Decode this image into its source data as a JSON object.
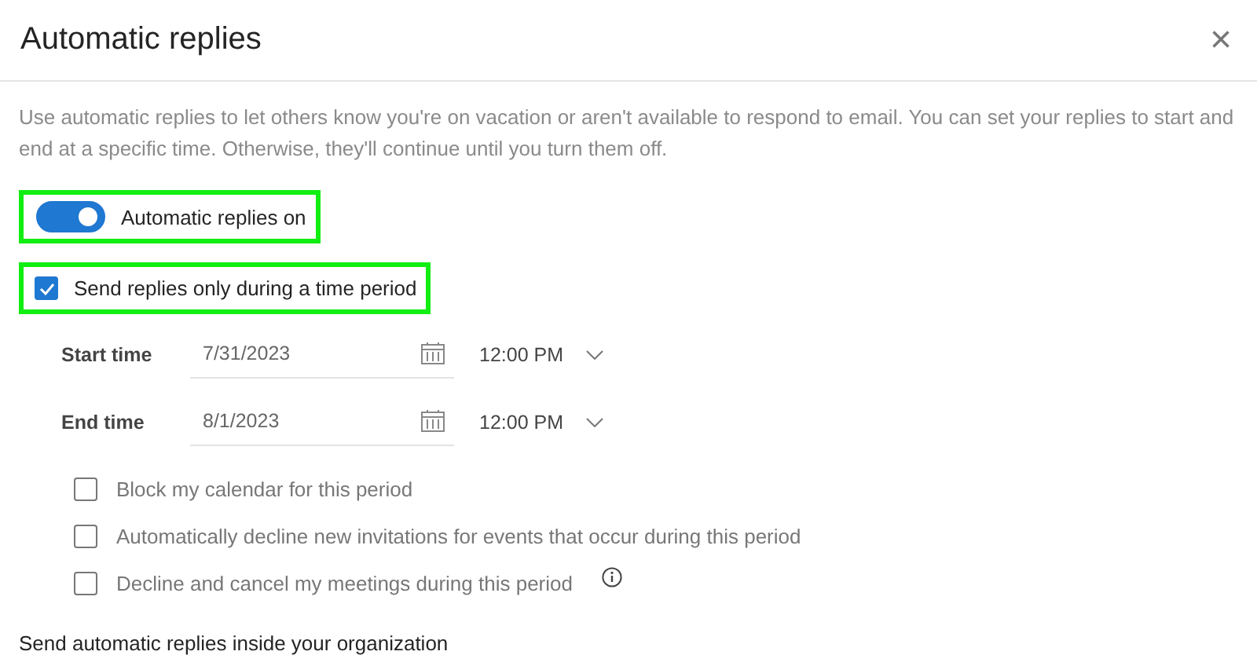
{
  "dialog": {
    "title": "Automatic replies",
    "close": "×"
  },
  "description": "Use automatic replies to let others know you're on vacation or aren't available to respond to email. You can set your replies to start and end at a specific time. Otherwise, they'll continue until you turn them off.",
  "toggle": {
    "label": "Automatic replies on",
    "on": true,
    "highlighted": true
  },
  "time_period": {
    "label": "Send replies only during a time period",
    "checked": true,
    "highlighted": true
  },
  "times": [
    {
      "label": "Start time",
      "date": "7/31/2023",
      "time": "12:00 PM"
    },
    {
      "label": "End time",
      "date": "8/1/2023",
      "time": "12:00 PM"
    }
  ],
  "options": [
    {
      "label": "Block my calendar for this period",
      "checked": false,
      "info": false
    },
    {
      "label": "Automatically decline new invitations for events that occur during this period",
      "checked": false,
      "info": false
    },
    {
      "label": "Decline and cancel my meetings during this period",
      "checked": false,
      "info": true
    }
  ],
  "section_label": "Send automatic replies inside your organization"
}
